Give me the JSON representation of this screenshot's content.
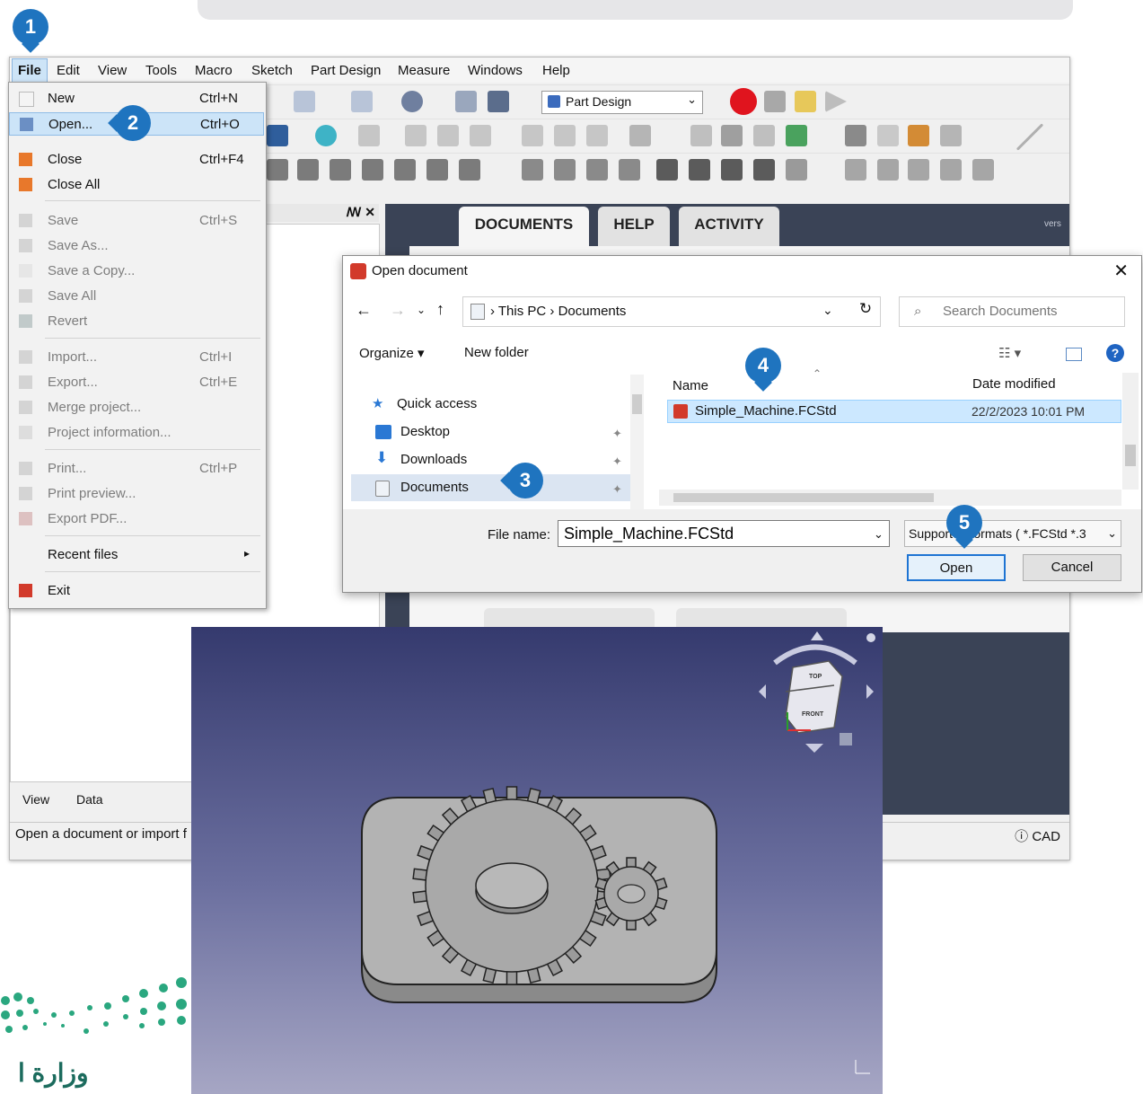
{
  "callouts": {
    "c1": "1",
    "c2": "2",
    "c3": "3",
    "c4": "4",
    "c5": "5"
  },
  "menubar": [
    "File",
    "Edit",
    "View",
    "Tools",
    "Macro",
    "Sketch",
    "Part Design",
    "Measure",
    "Windows",
    "Help"
  ],
  "workbench": "Part Design",
  "file_menu": {
    "new": {
      "label": "New",
      "shortcut": "Ctrl+N"
    },
    "open": {
      "label": "Open...",
      "shortcut": "Ctrl+O"
    },
    "close": {
      "label": "Close",
      "shortcut": "Ctrl+F4"
    },
    "close_all": {
      "label": "Close All"
    },
    "save": {
      "label": "Save",
      "shortcut": "Ctrl+S"
    },
    "save_as": {
      "label": "Save As..."
    },
    "save_copy": {
      "label": "Save a Copy..."
    },
    "save_all": {
      "label": "Save All"
    },
    "revert": {
      "label": "Revert"
    },
    "import": {
      "label": "Import...",
      "shortcut": "Ctrl+I"
    },
    "export": {
      "label": "Export...",
      "shortcut": "Ctrl+E"
    },
    "merge": {
      "label": "Merge project..."
    },
    "project_info": {
      "label": "Project information..."
    },
    "print": {
      "label": "Print...",
      "shortcut": "Ctrl+P"
    },
    "print_preview": {
      "label": "Print preview..."
    },
    "export_pdf": {
      "label": "Export PDF..."
    },
    "recent": {
      "label": "Recent files",
      "arrow": "▸"
    },
    "exit": {
      "label": "Exit"
    }
  },
  "start_page": {
    "tabs": [
      "DOCUMENTS",
      "HELP",
      "ACTIVITY"
    ],
    "version_text": "vers"
  },
  "panel_header_buttons": "ꟿ ✕",
  "left_tabs": [
    "View",
    "Data"
  ],
  "status": {
    "text": "Open a document or import f",
    "right": "CAD"
  },
  "dialog": {
    "title": "Open document",
    "close": "✕",
    "breadcrumb": "›  This PC  ›  Documents",
    "search_placeholder": "Search Documents",
    "organize": "Organize ▾",
    "new_folder": "New folder",
    "nav": {
      "quick_access": "Quick access",
      "desktop": "Desktop",
      "downloads": "Downloads",
      "documents": "Documents"
    },
    "columns": {
      "name": "Name",
      "date": "Date modified"
    },
    "file": {
      "name": "Simple_Machine.FCStd",
      "date": "22/2/2023 10:01 PM"
    },
    "file_name_label": "File name:",
    "file_name_value": "Simple_Machine.FCStd",
    "filter": "Supported formats ( *.FCStd *.3",
    "open_btn": "Open",
    "cancel_btn": "Cancel"
  },
  "navcube": {
    "top": "TOP",
    "front": "FRONT"
  },
  "logo_text": "وزارة ا",
  "colors": {
    "accent": "#1f74bf",
    "dialog_selection": "#cce8ff",
    "viewport_top": "#353a6e",
    "record": "#e0141e"
  }
}
